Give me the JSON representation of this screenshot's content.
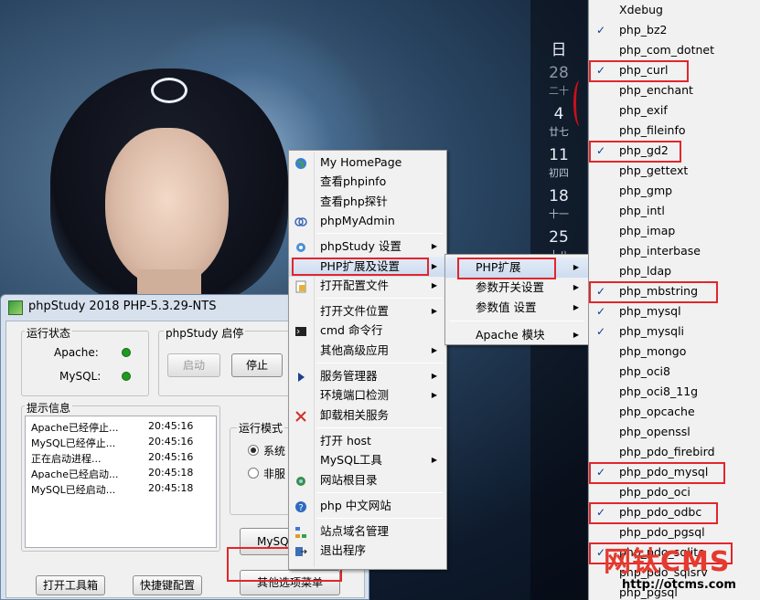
{
  "calendar": {
    "header": "日",
    "days": [
      {
        "day": "28",
        "sub": "二十",
        "dim": true
      },
      {
        "day": "4",
        "sub": "廿七",
        "dim": false
      },
      {
        "day": "11",
        "sub": "初四",
        "dim": false
      },
      {
        "day": "18",
        "sub": "十一",
        "dim": false
      },
      {
        "day": "25",
        "sub": "十八",
        "dim": false
      }
    ]
  },
  "window": {
    "title": "phpStudy 2018   PHP-5.3.29-NTS",
    "status_group": "运行状态",
    "apache_label": "Apache:",
    "mysql_label": "MySQL:",
    "status_color": "#1f9a1f",
    "control_group": "phpStudy 启停",
    "start_button": "启动",
    "stop_button": "停止",
    "log_group": "提示信息",
    "log": [
      {
        "msg": "Apache已经停止...",
        "time": "20:45:16"
      },
      {
        "msg": "MySQL已经停止...",
        "time": "20:45:16"
      },
      {
        "msg": "正在启动进程...",
        "time": "20:45:16"
      },
      {
        "msg": "Apache已经启动...",
        "time": "20:45:18"
      },
      {
        "msg": "MySQL已经启动...",
        "time": "20:45:18"
      }
    ],
    "mode_group": "运行模式",
    "mode_option1": "系统",
    "mode_option2": "非服",
    "mysql_button": "MySQL",
    "open_toolbox_button": "打开工具箱",
    "shortcut_button": "快捷键配置",
    "other_options_button": "其他选项菜单"
  },
  "main_menu": [
    {
      "label": "My HomePage",
      "icon": "globe-icon"
    },
    {
      "label": "查看phpinfo",
      "icon": ""
    },
    {
      "label": "查看php探针",
      "icon": ""
    },
    {
      "label": "phpMyAdmin",
      "icon": "rings-icon"
    },
    {
      "sep": true
    },
    {
      "label": "phpStudy 设置",
      "icon": "gear-icon",
      "arrow": true
    },
    {
      "label": "PHP扩展及设置",
      "icon": "",
      "arrow": true,
      "hl": true
    },
    {
      "label": "打开配置文件",
      "icon": "config-icon",
      "arrow": true
    },
    {
      "sep": true
    },
    {
      "label": "打开文件位置",
      "icon": "",
      "arrow": true
    },
    {
      "label": "cmd 命令行",
      "icon": "terminal-icon"
    },
    {
      "label": "其他高级应用",
      "icon": "",
      "arrow": true
    },
    {
      "sep": true
    },
    {
      "label": "服务管理器",
      "icon": "play-icon",
      "arrow": true
    },
    {
      "label": "环境端口检测",
      "icon": "",
      "arrow": true
    },
    {
      "label": "卸载相关服务",
      "icon": "uninstall-icon"
    },
    {
      "sep": true
    },
    {
      "label": "打开 host",
      "icon": ""
    },
    {
      "label": "MySQL工具",
      "icon": "",
      "arrow": true
    },
    {
      "label": "网站根目录",
      "icon": "web-icon"
    },
    {
      "sep": true
    },
    {
      "label": "php 中文网站",
      "icon": "help-icon"
    },
    {
      "sep": true
    },
    {
      "label": "站点域名管理",
      "icon": "sitemap-icon"
    },
    {
      "label": "退出程序",
      "icon": "exit-icon"
    }
  ],
  "sub_menu": [
    {
      "label": "PHP扩展",
      "arrow": true,
      "hl": true
    },
    {
      "label": "参数开关设置",
      "arrow": true
    },
    {
      "label": "参数值 设置",
      "arrow": true
    },
    {
      "sep": true
    },
    {
      "label": "Apache 模块",
      "arrow": true
    }
  ],
  "extensions": [
    {
      "name": "Xdebug",
      "checked": false
    },
    {
      "name": "php_bz2",
      "checked": true
    },
    {
      "name": "php_com_dotnet",
      "checked": false
    },
    {
      "name": "php_curl",
      "checked": true,
      "boxed": true
    },
    {
      "name": "php_enchant",
      "checked": false
    },
    {
      "name": "php_exif",
      "checked": false
    },
    {
      "name": "php_fileinfo",
      "checked": false
    },
    {
      "name": "php_gd2",
      "checked": true,
      "boxed": true
    },
    {
      "name": "php_gettext",
      "checked": false
    },
    {
      "name": "php_gmp",
      "checked": false
    },
    {
      "name": "php_intl",
      "checked": false
    },
    {
      "name": "php_imap",
      "checked": false
    },
    {
      "name": "php_interbase",
      "checked": false
    },
    {
      "name": "php_ldap",
      "checked": false
    },
    {
      "name": "php_mbstring",
      "checked": true,
      "boxed": true
    },
    {
      "name": "php_mysql",
      "checked": true
    },
    {
      "name": "php_mysqli",
      "checked": true
    },
    {
      "name": "php_mongo",
      "checked": false
    },
    {
      "name": "php_oci8",
      "checked": false
    },
    {
      "name": "php_oci8_11g",
      "checked": false
    },
    {
      "name": "php_opcache",
      "checked": false
    },
    {
      "name": "php_openssl",
      "checked": false
    },
    {
      "name": "php_pdo_firebird",
      "checked": false
    },
    {
      "name": "php_pdo_mysql",
      "checked": true,
      "boxed": true
    },
    {
      "name": "php_pdo_oci",
      "checked": false
    },
    {
      "name": "php_pdo_odbc",
      "checked": true,
      "boxed": true
    },
    {
      "name": "php_pdo_pgsql",
      "checked": false
    },
    {
      "name": "php_pdo_sqlite",
      "checked": true,
      "boxed": true
    },
    {
      "name": "php_pdo_sqlsrv",
      "checked": false
    },
    {
      "name": "php_pgsql",
      "checked": false
    }
  ],
  "watermark": {
    "brand": "网钛CMS",
    "url": "http://otcms.com"
  },
  "highlight_color": "#e2262b"
}
